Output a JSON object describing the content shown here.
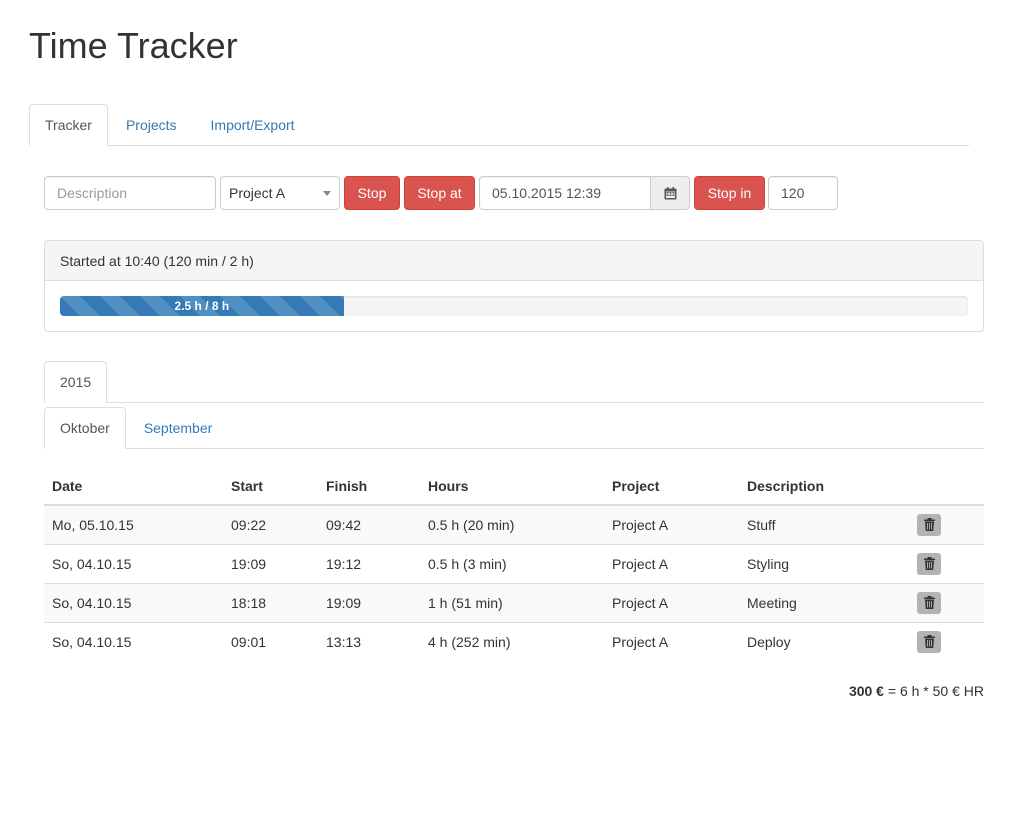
{
  "app": {
    "title": "Time Tracker"
  },
  "main_tabs": [
    {
      "label": "Tracker",
      "active": true
    },
    {
      "label": "Projects",
      "active": false
    },
    {
      "label": "Import/Export",
      "active": false
    }
  ],
  "controls": {
    "description_placeholder": "Description",
    "project_selected": "Project A",
    "stop_label": "Stop",
    "stop_at_label": "Stop at",
    "stop_at_value": "05.10.2015 12:39",
    "stop_in_label": "Stop in",
    "stop_in_value": "120"
  },
  "status": {
    "started_text": "Started at 10:40 (120 min / 2 h)",
    "progress_label": "2.5 h / 8 h",
    "progress_fraction": 0.3125
  },
  "year_tabs": [
    {
      "label": "2015",
      "active": true
    }
  ],
  "month_tabs": [
    {
      "label": "Oktober",
      "active": true
    },
    {
      "label": "September",
      "active": false
    }
  ],
  "table": {
    "headers": {
      "date": "Date",
      "start": "Start",
      "finish": "Finish",
      "hours": "Hours",
      "project": "Project",
      "description": "Description"
    },
    "rows": [
      {
        "date": "Mo, 05.10.15",
        "start": "09:22",
        "finish": "09:42",
        "hours": "0.5 h (20 min)",
        "project": "Project A",
        "description": "Stuff"
      },
      {
        "date": "So, 04.10.15",
        "start": "19:09",
        "finish": "19:12",
        "hours": "0.5 h (3 min)",
        "project": "Project A",
        "description": "Styling"
      },
      {
        "date": "So, 04.10.15",
        "start": "18:18",
        "finish": "19:09",
        "hours": "1 h (51 min)",
        "project": "Project A",
        "description": "Meeting"
      },
      {
        "date": "So, 04.10.15",
        "start": "09:01",
        "finish": "13:13",
        "hours": "4 h (252 min)",
        "project": "Project A",
        "description": "Deploy"
      }
    ]
  },
  "summary": {
    "total": "300 €",
    "formula": " = 6 h * 50 € HR"
  },
  "colors": {
    "accent": "#337ab7",
    "danger": "#d9534f"
  }
}
